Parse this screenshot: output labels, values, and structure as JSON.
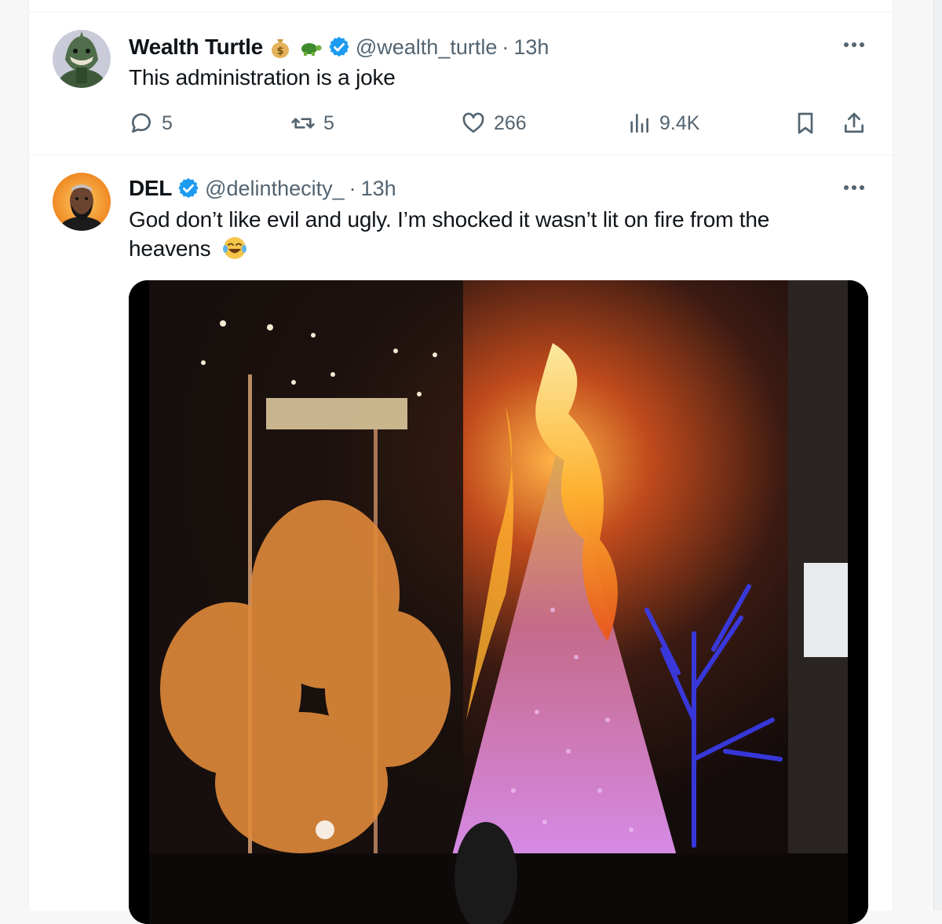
{
  "tweets": [
    {
      "name": "Wealth Turtle",
      "handle": "@wealth_turtle",
      "separator": "·",
      "time": "13h",
      "text": "This administration is a joke",
      "name_emojis": [
        "money-bag-icon",
        "turtle-icon"
      ],
      "stats": {
        "replies": "5",
        "reposts": "5",
        "likes": "266",
        "views": "9.4K"
      }
    },
    {
      "name": "DEL",
      "handle": "@delinthecity_",
      "separator": "·",
      "time": "13h",
      "text": "God don’t like evil and ugly. I’m shocked it wasn’t lit on fire from the heavens"
    }
  ],
  "colors": {
    "verified": "#1d9bf0",
    "secondary_text": "#536471",
    "border": "#eff3f4"
  }
}
